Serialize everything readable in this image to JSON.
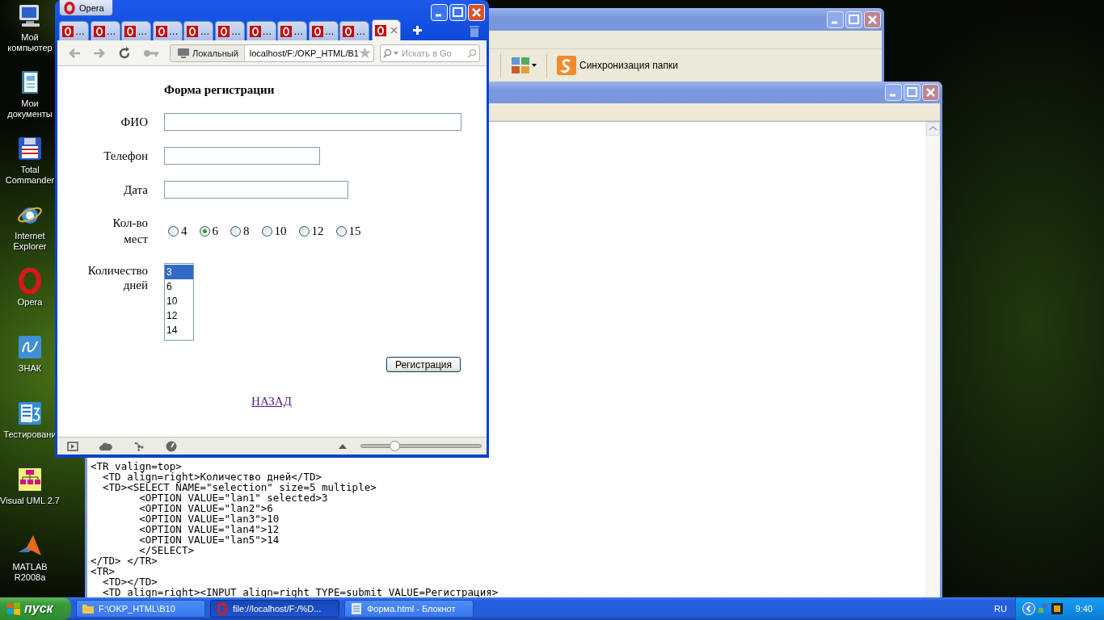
{
  "desktop": {
    "icons": [
      {
        "kind": "computer",
        "label": "Мой компьютер"
      },
      {
        "kind": "documents",
        "label": "Мои документы"
      },
      {
        "kind": "floppy",
        "label": "Total Commander"
      },
      {
        "kind": "ie",
        "label": "Internet Explorer"
      },
      {
        "kind": "opera",
        "label": "Opera"
      },
      {
        "kind": "znak",
        "label": "ЗНАК"
      },
      {
        "kind": "test",
        "label": "Тестировани"
      },
      {
        "kind": "uml",
        "label": "Visual UML 2.7"
      },
      {
        "kind": "matlab",
        "label": "MATLAB R2008a"
      }
    ]
  },
  "explorer_window": {
    "toolbar": {
      "sync_button": "Синхронизация папки"
    }
  },
  "notepad_window": {
    "code_lines": [
      "<TR valign=top>",
      "  <TD align=right>Количество дней</TD>",
      "  <TD><SELECT NAME=\"selection\" size=5 multiple>",
      "        <OPTION VALUE=\"lan1\" selected>3",
      "        <OPTION VALUE=\"lan2\">6",
      "        <OPTION VALUE=\"lan3\">10",
      "        <OPTION VALUE=\"lan4\">12",
      "        <OPTION VALUE=\"lan5\">14",
      "        </SELECT>",
      "</TD> </TR>",
      "<TR>",
      "  <TD></TD>",
      "  <TD align=right><INPUT align=right TYPE=submit VALUE=Регистрация>"
    ]
  },
  "browser_window": {
    "menu_button": "Opera",
    "tabs": [
      {
        "label": "…",
        "selected": false
      },
      {
        "label": "…",
        "selected": false
      },
      {
        "label": "…",
        "selected": false
      },
      {
        "label": "…",
        "selected": false
      },
      {
        "label": "…",
        "selected": false
      },
      {
        "label": "…",
        "selected": false
      },
      {
        "label": "…",
        "selected": false
      },
      {
        "label": "…",
        "selected": false
      },
      {
        "label": "…",
        "selected": false
      },
      {
        "label": "…",
        "selected": false
      },
      {
        "selected": true
      }
    ],
    "address_bar": {
      "badge": "Локальный",
      "url": "localhost/F:/OKP_HTML/B1"
    },
    "search": {
      "placeholder": "Искать в Go"
    },
    "page": {
      "title": "Форма регистрации",
      "fields": [
        {
          "kind": "text",
          "label": "ФИО"
        },
        {
          "kind": "text",
          "label": "Телефон"
        },
        {
          "kind": "text",
          "label": "Дата"
        },
        {
          "kind": "radio",
          "label": "Кол-во мест",
          "options": [
            {
              "label": "4",
              "selected": false
            },
            {
              "label": "6",
              "selected": true
            },
            {
              "label": "8",
              "selected": false
            },
            {
              "label": "10",
              "selected": false
            },
            {
              "label": "12",
              "selected": false
            },
            {
              "label": "15",
              "selected": false
            }
          ]
        },
        {
          "kind": "listbox",
          "label": "Количество дней",
          "options": [
            {
              "label": "3",
              "selected": true
            },
            {
              "label": "6",
              "selected": false
            },
            {
              "label": "10",
              "selected": false
            },
            {
              "label": "12",
              "selected": false
            },
            {
              "label": "14",
              "selected": false
            }
          ]
        }
      ],
      "submit": "Регистрация",
      "back_link": "НАЗАД"
    },
    "status_bar": {
      "zoom": {
        "level": 0.27
      }
    }
  },
  "taskbar": {
    "start": "пуск",
    "tasks": [
      {
        "kind": "folder",
        "label": "F:\\OKP_HTML\\B10",
        "selected": false
      },
      {
        "kind": "browser",
        "label": "file://localhost/F:/%D...",
        "selected": true
      },
      {
        "kind": "notepad",
        "label": "Форма.html - Блокнот",
        "selected": false
      }
    ],
    "language": "RU",
    "time": "9:40"
  }
}
